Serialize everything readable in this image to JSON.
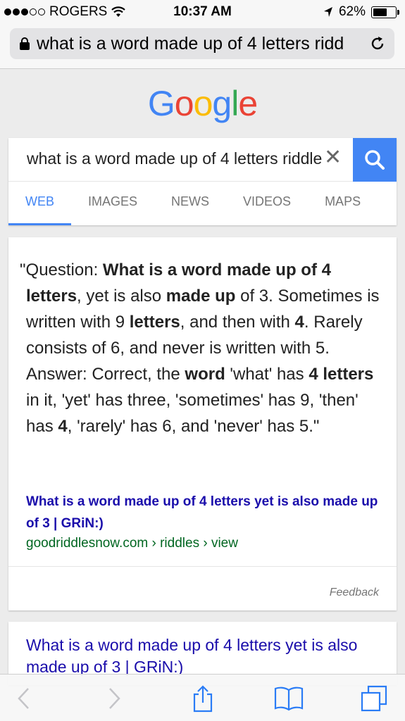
{
  "status_bar": {
    "carrier": "ROGERS",
    "time": "10:37 AM",
    "battery_percent_text": "62%",
    "battery_level": 0.62
  },
  "address_bar": {
    "url_text": "what is a word made up of 4 letters ridd"
  },
  "logo": {
    "letters": [
      "G",
      "o",
      "o",
      "g",
      "l",
      "e"
    ],
    "colors": [
      "#4285F4",
      "#EA4335",
      "#FBBC05",
      "#4285F4",
      "#34A853",
      "#EA4335"
    ]
  },
  "search": {
    "query": "what is a word made up of 4 letters riddle",
    "accent_color": "#4285F4"
  },
  "tabs": [
    {
      "label": "WEB",
      "active": true
    },
    {
      "label": "IMAGES",
      "active": false
    },
    {
      "label": "NEWS",
      "active": false
    },
    {
      "label": "VIDEOS",
      "active": false
    },
    {
      "label": "MAPS",
      "active": false
    }
  ],
  "featured_result": {
    "snippet": [
      {
        "t": "\"Question: ",
        "b": false
      },
      {
        "t": "What is a word made up of 4 letters",
        "b": true
      },
      {
        "t": ", yet is also ",
        "b": false
      },
      {
        "t": "made up",
        "b": true
      },
      {
        "t": " of 3. Sometimes is written with 9 ",
        "b": false
      },
      {
        "t": "letters",
        "b": true
      },
      {
        "t": ", and then with ",
        "b": false
      },
      {
        "t": "4",
        "b": true
      },
      {
        "t": ". Rarely consists of 6, and never is written with 5. Answer: Correct, the ",
        "b": false
      },
      {
        "t": "word",
        "b": true
      },
      {
        "t": " 'what' has ",
        "b": false
      },
      {
        "t": "4 letters",
        "b": true
      },
      {
        "t": " in it, 'yet' has three, 'sometimes' has 9, 'then' has ",
        "b": false
      },
      {
        "t": "4",
        "b": true
      },
      {
        "t": ", 'rarely' has 6, and 'never' has 5.\"",
        "b": false
      }
    ],
    "link_title": "What is a word made up of 4 letters yet is also made up of 3 | GRiN:)",
    "url": "goodriddlesnow.com › riddles › view",
    "feedback": "Feedback"
  },
  "second_result": {
    "link_title": "What is a word made up of 4 letters yet is also made up of 3 | GRiN:)"
  },
  "toolbar": {
    "icons": [
      "back-icon",
      "forward-icon",
      "share-icon",
      "bookmarks-icon",
      "tabs-icon"
    ]
  }
}
